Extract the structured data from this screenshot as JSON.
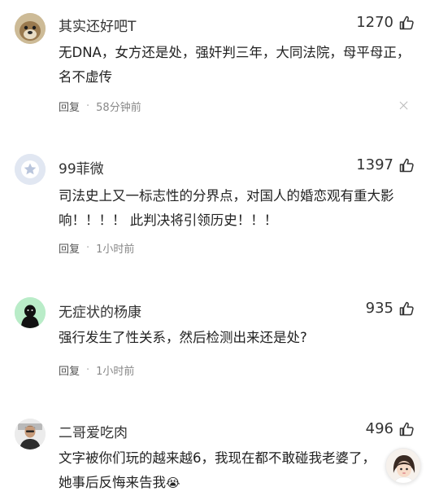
{
  "comments": [
    {
      "username": "其实还好吧T",
      "likes": "1270",
      "content": "无DNA，女方还是处，强奸判三年，大同法院，母平母正，名不虚传",
      "reply_label": "回复",
      "separator": "·",
      "time": "58分钟前",
      "avatar_icon": "dog-avatar-icon"
    },
    {
      "username": "99菲微",
      "likes": "1397",
      "content": "司法史上又一标志性的分界点，对国人的婚恋观有重大影响！！！！ 此判决将引领历史！！！",
      "reply_label": "回复",
      "separator": "·",
      "time": "1小时前",
      "avatar_icon": "default-star-avatar-icon"
    },
    {
      "username": "无症状的杨康",
      "likes": "935",
      "content": "强行发生了性关系，然后检测出来还是处?",
      "reply_label": "回复",
      "separator": "·",
      "time": "1小时前",
      "avatar_icon": "black-silhouette-avatar-icon"
    },
    {
      "username": "二哥爱吃肉",
      "likes": "496",
      "content": "文字被你们玩的越来越6，我现在都不敢碰我老婆了，她事后反悔来告我",
      "emoji": "😭",
      "avatar_icon": "person-photo-avatar-icon"
    }
  ],
  "floating_avatar_icon": "girl-avatar-icon",
  "colors": {
    "text": "#222222",
    "meta": "#888888",
    "close": "#b8b8b8",
    "avatar3_bg": "#b9ecc8"
  }
}
